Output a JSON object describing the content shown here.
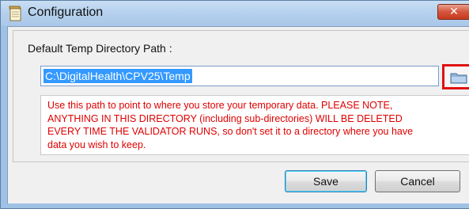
{
  "window": {
    "title": "Configuration",
    "close_glyph": "✕"
  },
  "path_section": {
    "label": "Default Temp Directory Path :",
    "value": "C:\\DigitalHealth\\CPV25\\Temp",
    "browse_icon": "folder-icon"
  },
  "warning": {
    "text": "Use this path to point to where you store your temporary data. PLEASE NOTE,\nANYTHING IN THIS DIRECTORY (including sub-directories) WILL BE DELETED\nEVERY TIME THE VALIDATOR RUNS, so don't set it to a directory where you have\ndata you wish to keep.",
    "color": "#e00000"
  },
  "buttons": {
    "save": "Save",
    "cancel": "Cancel"
  },
  "colors": {
    "highlight_box": "#e01010",
    "selection": "#3399ff"
  }
}
